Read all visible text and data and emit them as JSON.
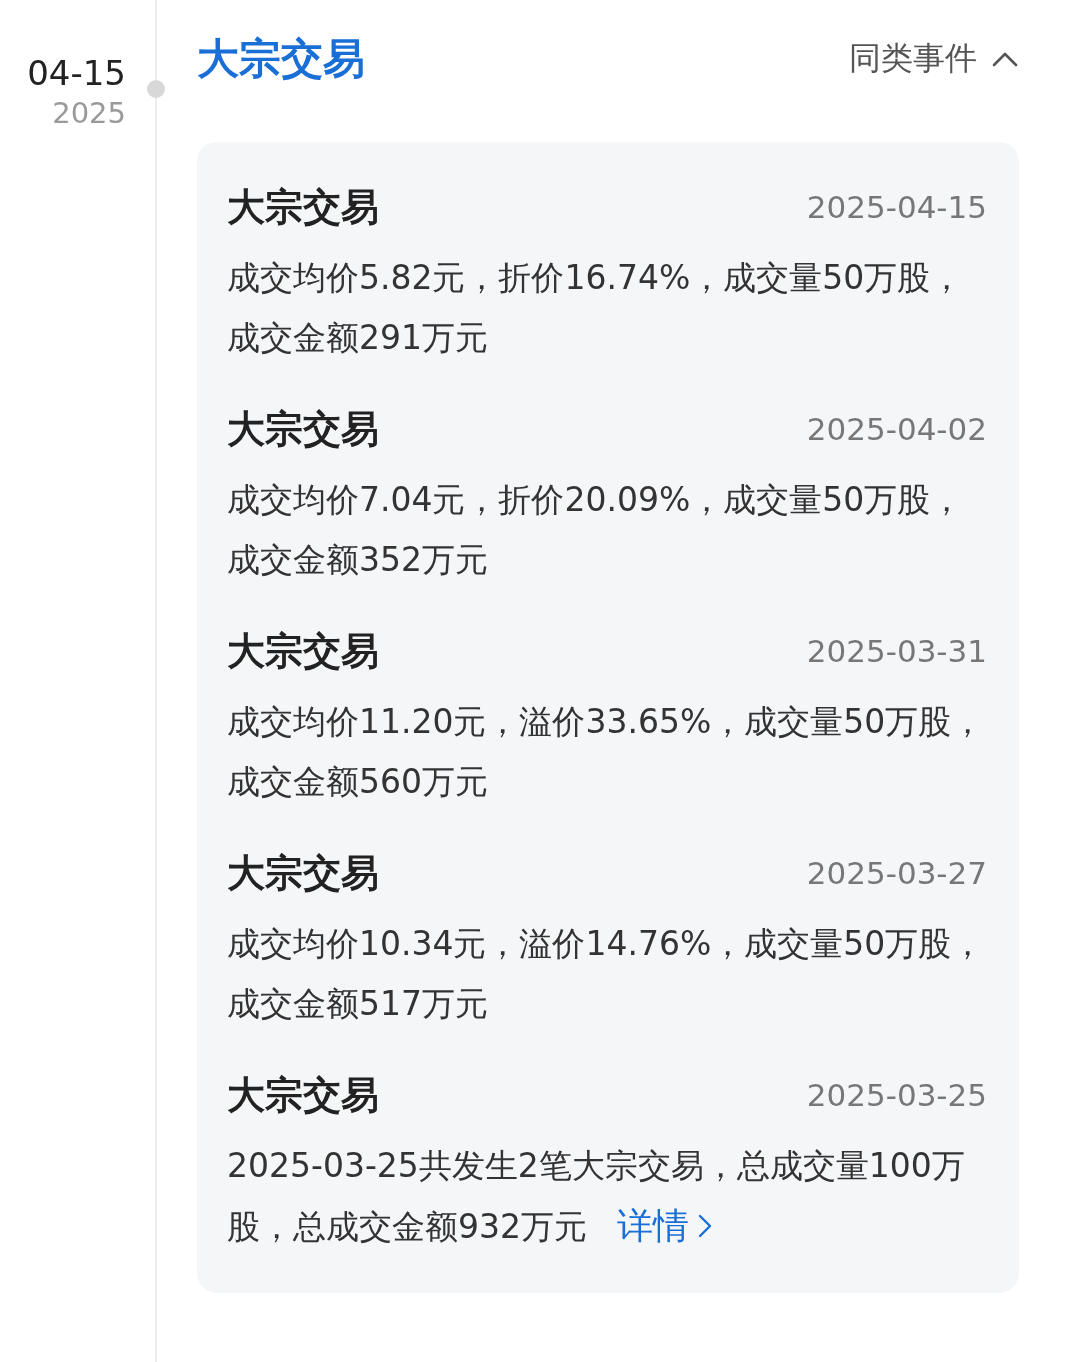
{
  "timeline": {
    "date": "04-15",
    "year": "2025"
  },
  "event": {
    "title": "大宗交易",
    "related": {
      "label": "同类事件",
      "expanded": true
    }
  },
  "items": [
    {
      "title": "大宗交易",
      "date": "2025-04-15",
      "text": "成交均价5.82元，折价16.74%，成交量50万股，成交金额291万元"
    },
    {
      "title": "大宗交易",
      "date": "2025-04-02",
      "text": "成交均价7.04元，折价20.09%，成交量50万股，成交金额352万元"
    },
    {
      "title": "大宗交易",
      "date": "2025-03-31",
      "text": "成交均价11.20元，溢价33.65%，成交量50万股，成交金额560万元"
    },
    {
      "title": "大宗交易",
      "date": "2025-03-27",
      "text": "成交均价10.34元，溢价14.76%，成交量50万股，成交金额517万元"
    },
    {
      "title": "大宗交易",
      "date": "2025-03-25",
      "text": "2025-03-25共发生2笔大宗交易，总成交量100万股，总成交金额932万元",
      "link": "详情"
    }
  ]
}
